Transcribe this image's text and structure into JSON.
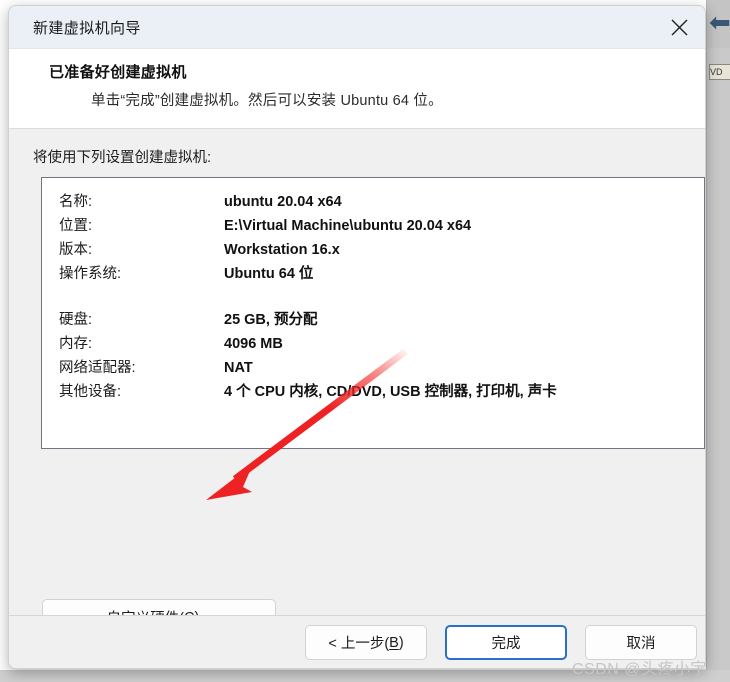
{
  "window": {
    "title": "新建虚拟机向导",
    "close_icon": "close-icon"
  },
  "header": {
    "title": "已准备好创建虚拟机",
    "subtitle": "单击“完成”创建虚拟机。然后可以安装 Ubuntu 64 位。"
  },
  "body": {
    "intro": "将使用下列设置创建虚拟机:",
    "settings_group_1": [
      {
        "label": "名称:",
        "value": "ubuntu 20.04 x64"
      },
      {
        "label": "位置:",
        "value": "E:\\Virtual Machine\\ubuntu 20.04 x64"
      },
      {
        "label": "版本:",
        "value": "Workstation 16.x"
      },
      {
        "label": "操作系统:",
        "value": "Ubuntu 64 位"
      }
    ],
    "settings_group_2": [
      {
        "label": "硬盘:",
        "value": "25 GB, 预分配"
      },
      {
        "label": "内存:",
        "value": "4096 MB"
      },
      {
        "label": "网络适配器:",
        "value": "NAT"
      },
      {
        "label": "其他设备:",
        "value": "4 个 CPU 内核, CD/DVD, USB 控制器, 打印机, 声卡"
      }
    ],
    "custom_hardware_button": {
      "prefix": "自定义硬件(",
      "accelerator": "C",
      "suffix": ")..."
    }
  },
  "footer": {
    "back_button": {
      "prefix": "< 上一步(",
      "accelerator": "B",
      "suffix": ")"
    },
    "finish_button": {
      "label": "完成"
    },
    "cancel_button": {
      "label": "取消"
    }
  },
  "annotation": {
    "arrow_color": "#ee2222",
    "description": "红色箭头指向自定义硬件按钮"
  },
  "watermark": {
    "text": "CSDN @头疼小宇"
  },
  "background": {
    "back_arrow_icon": "back-arrow-icon",
    "tab_label": "VD"
  }
}
